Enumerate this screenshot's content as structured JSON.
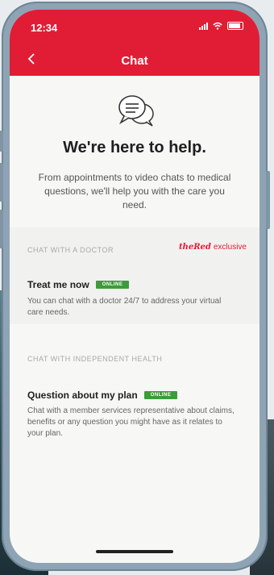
{
  "status": {
    "time": "12:34"
  },
  "header": {
    "title": "Chat",
    "back_icon": "chevron-left-icon"
  },
  "hero": {
    "icon": "chat-bubbles-icon",
    "heading": "We're here to help.",
    "intro": "From appointments to video chats to medical questions, we'll help you with the care you need."
  },
  "sections": [
    {
      "label": "CHAT WITH A DOCTOR",
      "exclusive_brand": "theRed",
      "exclusive_text": "exclusive",
      "item": {
        "title": "Treat me now",
        "badge": "ONLINE",
        "description": "You can chat with a doctor 24/7 to address your virtual care needs."
      }
    },
    {
      "label": "CHAT WITH INDEPENDENT HEALTH",
      "item": {
        "title": "Question about my plan",
        "badge": "ONLINE",
        "description": "Chat with a member services representative about claims, benefits or any question you might have as it relates to your plan."
      }
    }
  ],
  "colors": {
    "brand_red": "#e11d36",
    "online_green": "#3d9b3d"
  }
}
